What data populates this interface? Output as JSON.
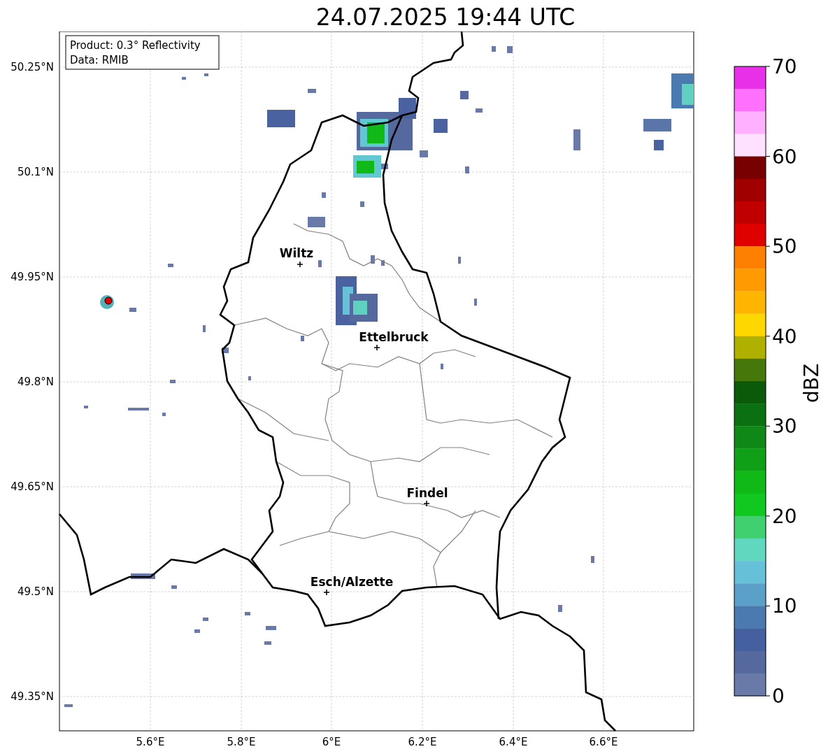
{
  "title": "24.07.2025 19:44 UTC",
  "info_box": {
    "lines": [
      "Product: 0.3° Reflectivity",
      "Data: RMIB"
    ]
  },
  "map": {
    "yticks": [
      "50.25°N",
      "50.1°N",
      "49.95°N",
      "49.8°N",
      "49.65°N",
      "49.5°N",
      "49.35°N"
    ],
    "xticks": [
      "5.6°E",
      "5.8°E",
      "6°E",
      "6.2°E",
      "6.4°E",
      "6.6°E"
    ],
    "places": [
      {
        "name": "Wiltz"
      },
      {
        "name": "Ettelbruck"
      },
      {
        "name": "Findel"
      },
      {
        "name": "Esch/Alzette"
      }
    ]
  },
  "colorbar": {
    "label": "dBZ",
    "ticks": [
      "70",
      "60",
      "50",
      "40",
      "30",
      "20",
      "10",
      "0"
    ],
    "bands": [
      {
        "color": "#e830e8"
      },
      {
        "color": "#ff70ff"
      },
      {
        "color": "#ffb0ff"
      },
      {
        "color": "#ffe0ff"
      },
      {
        "color": "#780000"
      },
      {
        "color": "#a00000"
      },
      {
        "color": "#c00000"
      },
      {
        "color": "#e00000"
      },
      {
        "color": "#ff7f00"
      },
      {
        "color": "#ff9a00"
      },
      {
        "color": "#ffb400"
      },
      {
        "color": "#ffd700"
      },
      {
        "color": "#b0b000"
      },
      {
        "color": "#46770a"
      },
      {
        "color": "#0a5a0a"
      },
      {
        "color": "#0a7010"
      },
      {
        "color": "#108818"
      },
      {
        "color": "#10a018"
      },
      {
        "color": "#10b818"
      },
      {
        "color": "#10c820"
      },
      {
        "color": "#40d070"
      },
      {
        "color": "#60d8c0"
      },
      {
        "color": "#66c0d8"
      },
      {
        "color": "#5aa0c8"
      },
      {
        "color": "#4a7ab0"
      },
      {
        "color": "#4560a0"
      },
      {
        "color": "#55699f"
      },
      {
        "color": "#6a7aa8"
      }
    ]
  }
}
